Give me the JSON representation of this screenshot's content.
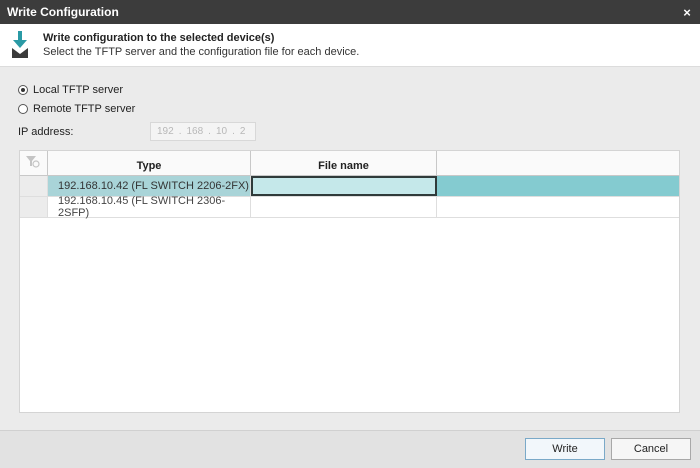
{
  "window": {
    "title": "Write Configuration",
    "close_glyph": "×"
  },
  "header": {
    "title": "Write configuration to the selected device(s)",
    "subtitle": "Select the TFTP server and the configuration file for each device.",
    "icon": "download-to-device-icon",
    "icon_color": "#2a9aa5"
  },
  "server": {
    "options": [
      {
        "label": "Local TFTP server",
        "checked": true
      },
      {
        "label": "Remote TFTP server",
        "checked": false
      }
    ],
    "ip_label": "IP address:",
    "ip_octets": [
      "192",
      "168",
      "10",
      "2"
    ]
  },
  "grid": {
    "columns": [
      "Type",
      "File name"
    ],
    "rows": [
      {
        "type": "192.168.10.42 (FL SWITCH 2206-2FX)",
        "file": "",
        "selected": true
      },
      {
        "type": "192.168.10.45 (FL SWITCH 2306-2SFP)",
        "file": "",
        "selected": false
      }
    ]
  },
  "footer": {
    "write_label": "Write",
    "cancel_label": "Cancel"
  },
  "colors": {
    "accent": "#84cbd0",
    "title_bar": "#3c3c3c"
  }
}
